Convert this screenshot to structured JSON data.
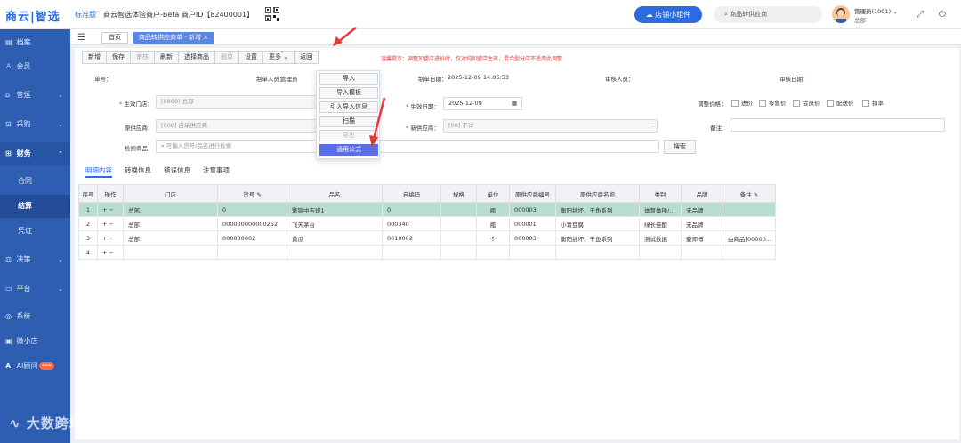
{
  "topbar": {
    "logo": "商云|智选",
    "edition": "标准版",
    "merchant": "商云智选体验商户-Beta  商户ID【82400001】",
    "helper_button": "店铺小组件",
    "search_placeholder": "商品转供应商",
    "user_name": "管理员(1001)",
    "user_org": "总部"
  },
  "sidebar": {
    "items": [
      {
        "label": "档案",
        "icon": "archive-icon"
      },
      {
        "label": "会员",
        "icon": "user-icon"
      },
      {
        "label": "营运",
        "icon": "store-icon"
      },
      {
        "label": "采购",
        "icon": "cart-icon"
      },
      {
        "label": "财务",
        "icon": "finance-icon"
      },
      {
        "label": "决策",
        "icon": "decision-icon"
      },
      {
        "label": "平台",
        "icon": "platform-icon"
      },
      {
        "label": "系统",
        "icon": "system-icon"
      },
      {
        "label": "微小店",
        "icon": "shop-icon"
      },
      {
        "label": "AI顾问",
        "icon": "ai-icon"
      }
    ],
    "sub_items": [
      "合同",
      "结算",
      "凭证"
    ],
    "new_badge": "new",
    "watermark": "大数跨境"
  },
  "tabs": {
    "home": "首页",
    "current": "商品转供应商单 - 新增"
  },
  "toolbar": {
    "buttons": [
      "新增",
      "保存",
      "审核",
      "刷新",
      "选择商品",
      "删单",
      "设置",
      "更多",
      "返回"
    ],
    "warning": "温馨提示：调整加盟店进价时，仅对纯加盟店生效，混合型分店不适用此调整"
  },
  "more_menu": [
    "导入",
    "导入模板",
    "引入导入信息",
    "扫描",
    "导出",
    "通用公式"
  ],
  "form": {
    "doc_no_label": "单号：",
    "maker_label": "制单人员：",
    "maker_value": "管理员",
    "make_date_label": "制单日期：",
    "make_date_value": "2025-12-09 14:06:53",
    "reviewer_label": "审核人员：",
    "review_date_label": "审核日期：",
    "store_label": "生效门店：",
    "store_value": "[8888]  总部",
    "effective_date_label": "生效日期：",
    "effective_date_value": "2025-12-09",
    "orig_supplier_label": "原供应商：",
    "orig_supplier_value": "[000]  自采供应商",
    "new_supplier_label": "新供应商：",
    "new_supplier_value": "[00]    不详",
    "remind_label": "调整价格：",
    "checks": [
      "进价",
      "零售价",
      "会员价",
      "配送价",
      "扣率"
    ],
    "remark_label": "备注：",
    "search_label": "检索商品：",
    "search_placeholder": "可输入货号/品名进行检索",
    "search_button": "搜索"
  },
  "subtabs": [
    "明细内容",
    "转换信息",
    "错误信息",
    "注意事项"
  ],
  "table": {
    "headers": [
      "序号",
      "操作",
      "门店",
      "货号",
      "品名",
      "自编码",
      "规格",
      "单位",
      "原供应商编号",
      "原供应商名称",
      "类别",
      "品牌",
      "备注"
    ],
    "rows": [
      {
        "no": "1",
        "ops": "+ −",
        "store": "总部",
        "code": "0",
        "name": "繁锦中吉班1",
        "self_code": "0",
        "spec": "",
        "unit": "瓶",
        "sup_no": "000003",
        "sup_name": "衡阳插坏、千鱼系列",
        "category": "体育体操/...",
        "brand": "无品牌",
        "remark": ""
      },
      {
        "no": "2",
        "ops": "+ −",
        "store": "总部",
        "code": "000000000000252",
        "name": "飞天茅台",
        "self_code": "000340",
        "spec": "",
        "unit": "瓶",
        "sup_no": "000001",
        "sup_name": "小青豆腐",
        "category": "绿长佳酿",
        "brand": "无品牌",
        "remark": ""
      },
      {
        "no": "3",
        "ops": "+ −",
        "store": "总部",
        "code": "000000002",
        "name": "黄瓜",
        "self_code": "0010002",
        "spec": "",
        "unit": "个",
        "sup_no": "000003",
        "sup_name": "衡阳插坏、千鱼系列",
        "category": "测试数据",
        "brand": "豪师傅",
        "remark": "由商品[00000..."
      },
      {
        "no": "4",
        "ops": "+ −",
        "store": "",
        "code": "",
        "name": "",
        "self_code": "",
        "spec": "",
        "unit": "",
        "sup_no": "",
        "sup_name": "",
        "category": "",
        "brand": "",
        "remark": ""
      }
    ]
  }
}
